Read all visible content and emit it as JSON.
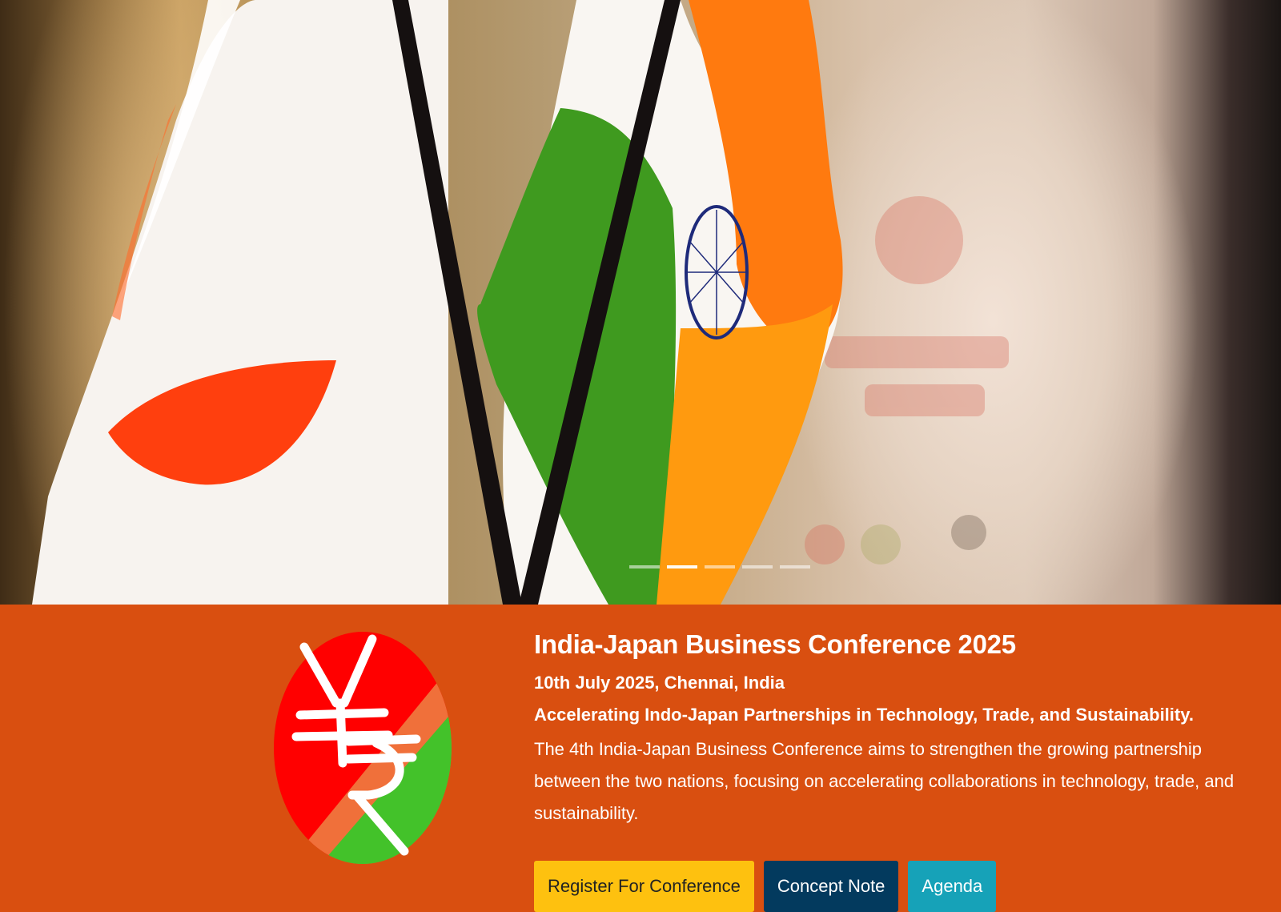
{
  "hero": {
    "carousel": {
      "slide_count": 5,
      "active_index": 1
    }
  },
  "conference": {
    "title": "India-Japan Business Conference 2025",
    "date_location": "10th July 2025, Chennai, India",
    "tagline": "Accelerating Indo-Japan Partnerships in Technology, Trade, and Sustainability.",
    "description": "The 4th India-Japan Business Conference aims to strengthen the growing partnership between the two nations, focusing on accelerating collaborations in technology, trade, and sustainability."
  },
  "buttons": {
    "register": "Register For Conference",
    "concept_note": "Concept Note",
    "agenda": "Agenda"
  },
  "colors": {
    "band": "#d94f10",
    "register_button": "#fec10f",
    "concept_button": "#033a5e",
    "agenda_button": "#16a2b8"
  },
  "logo": {
    "symbols": "yen-rupee-logo"
  }
}
